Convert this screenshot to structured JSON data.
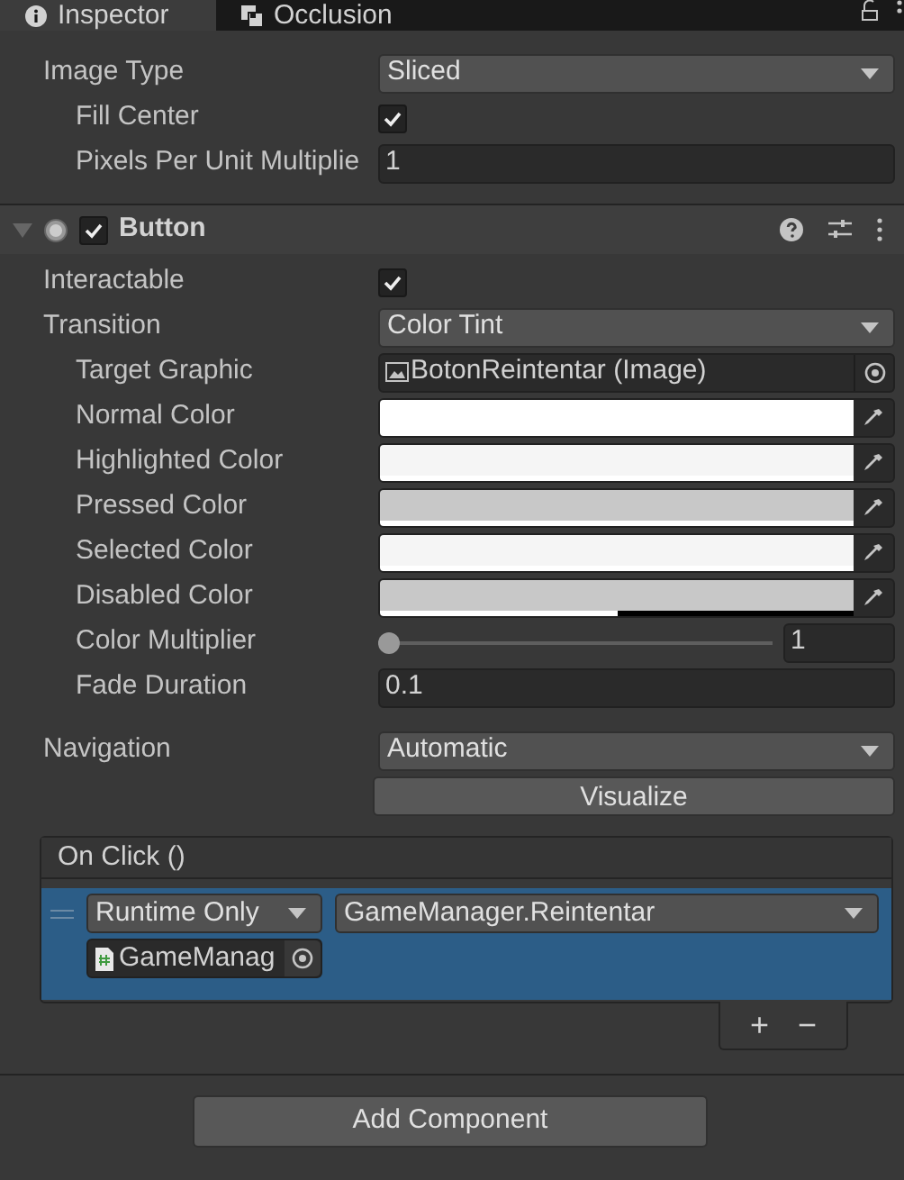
{
  "tabs": [
    {
      "label": "Inspector",
      "selected": true,
      "kind": "info"
    },
    {
      "label": "Occlusion",
      "selected": false,
      "kind": "occlusion"
    }
  ],
  "image_fields": [
    {
      "kind": "dropdown",
      "label": "Image Type",
      "value": "Sliced",
      "children": [
        {
          "kind": "checkbox",
          "label": "Fill Center",
          "checked": true
        },
        {
          "kind": "text",
          "label": "Pixels Per Unit Multiplie",
          "value": "1"
        }
      ]
    }
  ],
  "component": {
    "title": "Button",
    "expanded": true,
    "enabled": true
  },
  "button_fields": [
    {
      "kind": "checkbox",
      "label": "Interactable",
      "checked": true
    },
    {
      "kind": "dropdown",
      "label": "Transition",
      "value": "Color Tint",
      "children": [
        {
          "kind": "object",
          "label": "Target Graphic",
          "value": "BotonReintentar (Image)"
        },
        {
          "kind": "color",
          "label": "Normal Color",
          "color": "#ffffff",
          "level": 1
        },
        {
          "kind": "color",
          "label": "Highlighted Color",
          "color": "#f5f5f5",
          "level": 1
        },
        {
          "kind": "color",
          "label": "Pressed Color",
          "color": "#c8c8c8",
          "level": 1
        },
        {
          "kind": "color",
          "label": "Selected Color",
          "color": "#f5f5f5",
          "level": 1
        },
        {
          "kind": "color",
          "label": "Disabled Color",
          "color": "#c8c8c8",
          "level": 0.5
        },
        {
          "kind": "slider",
          "label": "Color Multiplier",
          "level": 0,
          "value": "1"
        },
        {
          "kind": "text",
          "label": "Fade Duration",
          "value": "0.1"
        }
      ]
    }
  ],
  "navigation": {
    "label": "Navigation",
    "value": "Automatic",
    "button": "Visualize"
  },
  "on_click": {
    "title": "On Click ()",
    "entries": [
      {
        "selected": true,
        "mode": "Runtime Only",
        "function": "GameManager.Reintentar",
        "target": "GameManag"
      }
    ],
    "add": "+",
    "remove": "−"
  },
  "add_component": "Add Component"
}
